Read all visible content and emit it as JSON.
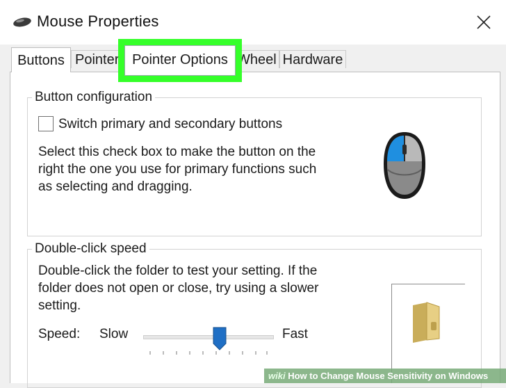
{
  "window": {
    "title": "Mouse Properties",
    "icon": "mouse-icon",
    "close_icon": "close-icon"
  },
  "tabs": [
    {
      "label": "Buttons",
      "active": true
    },
    {
      "label": "Pointers"
    },
    {
      "label": "Pointer Options",
      "highlighted": true
    },
    {
      "label": "Wheel"
    },
    {
      "label": "Hardware"
    }
  ],
  "button_configuration": {
    "title": "Button configuration",
    "checkbox_label": "Switch primary and secondary buttons",
    "checked": false,
    "description_lines": [
      "Select this check box to make the button on the",
      "right the one you use for primary functions such",
      "as selecting and dragging."
    ],
    "illustration_icon": "mouse-illustration-icon"
  },
  "double_click_speed": {
    "title": "Double-click speed",
    "description_lines": [
      "Double-click the folder to test your setting. If the",
      "folder does not open or close, try using a slower",
      "setting."
    ],
    "speed_label": "Speed:",
    "slow_label": "Slow",
    "fast_label": "Fast",
    "slider_value_fraction": 0.58,
    "test_folder_icon": "folder-icon"
  },
  "watermark": {
    "brand": "wiki",
    "text": "How to Change Mouse Sensitivity on Windows"
  },
  "colors": {
    "highlight": "#35ff2a",
    "slider_thumb": "#1f6fc5",
    "mouse_accent": "#1f8fe0"
  }
}
